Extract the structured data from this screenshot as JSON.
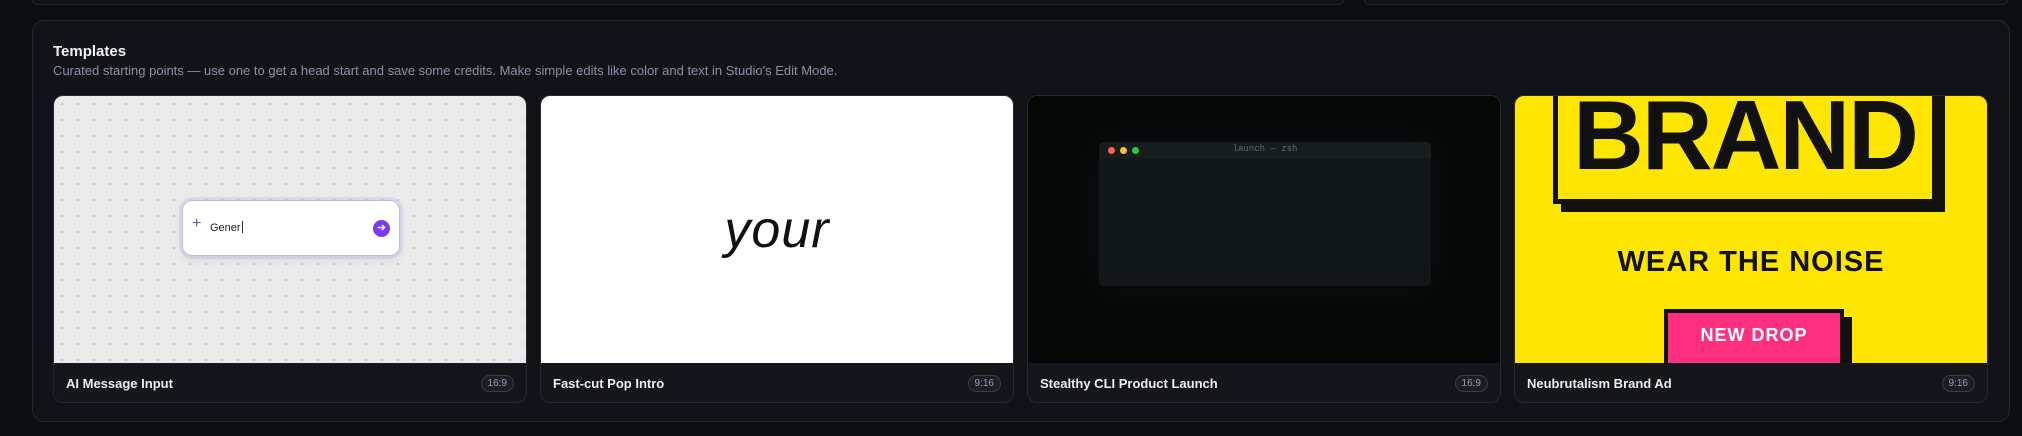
{
  "panel": {
    "title": "Templates",
    "subtitle": "Curated starting points — use one to get a head start and save some credits. Make simple edits like color and text in Studio's Edit Mode."
  },
  "cards": [
    {
      "title": "AI Message Input",
      "ratio": "16:9",
      "preview": {
        "input_text": "Gener",
        "sparkle_icon": "sparkle-icon",
        "send_icon": "arrow-right-icon",
        "accent": "#7c3aed"
      }
    },
    {
      "title": "Fast-cut Pop Intro",
      "ratio": "9:16",
      "preview": {
        "word": "your"
      }
    },
    {
      "title": "Stealthy CLI Product Launch",
      "ratio": "16:9",
      "preview": {
        "terminal_title": "launch — zsh",
        "dot_colors": [
          "#ff5f57",
          "#febc2e",
          "#28c840"
        ]
      }
    },
    {
      "title": "Neubrutalism Brand Ad",
      "ratio": "9:16",
      "preview": {
        "brand": "BRAND",
        "tagline": "WEAR THE NOISE",
        "cta": "NEW DROP",
        "bg": "#ffe600",
        "cta_color": "#ff2e7e"
      }
    }
  ]
}
